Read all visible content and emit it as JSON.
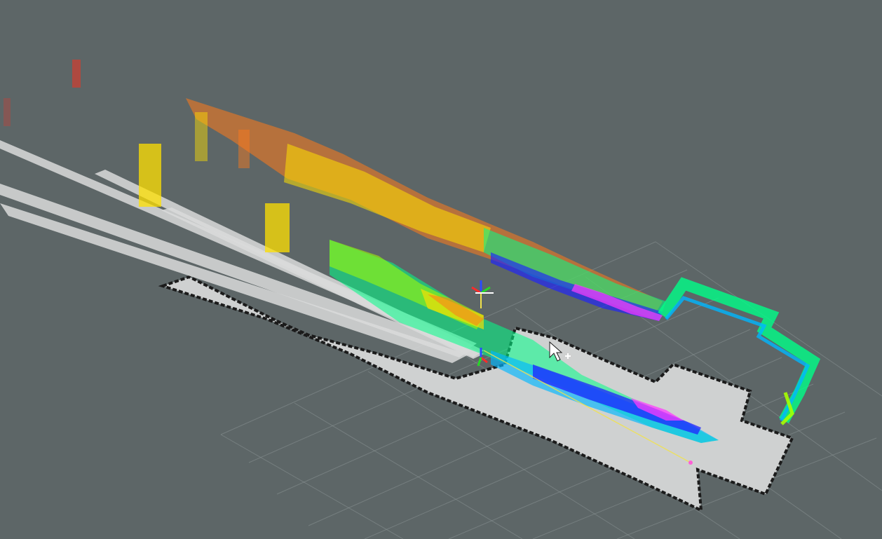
{
  "viewer": {
    "type": "3d-point-cloud-map",
    "background": "#5d6667",
    "grid_color": "#8a9394",
    "map_free_color": "#cfd1d1",
    "map_obstacle_color": "#1b1b1b",
    "colormap": [
      "#ff3bff",
      "#1d22ff",
      "#00b7ff",
      "#00ff88",
      "#a6ff00",
      "#ffe000",
      "#ff7a1a",
      "#ff2b1a"
    ]
  },
  "scene": {
    "axes_marker": {
      "x_color": "#ff2a2a",
      "y_color": "#26d926",
      "z_color": "#2a4bff"
    },
    "robot_frame_marker": {
      "x_color": "#ff2a2a",
      "y_color": "#26d926",
      "z_color": "#2a4bff"
    },
    "goal_marker": {
      "color": "#ff5fd6"
    }
  },
  "ui": {
    "cursor": {
      "icon": "mouse-pointer-icon"
    },
    "move_cursor": {
      "icon": "move-cursor-icon"
    }
  }
}
